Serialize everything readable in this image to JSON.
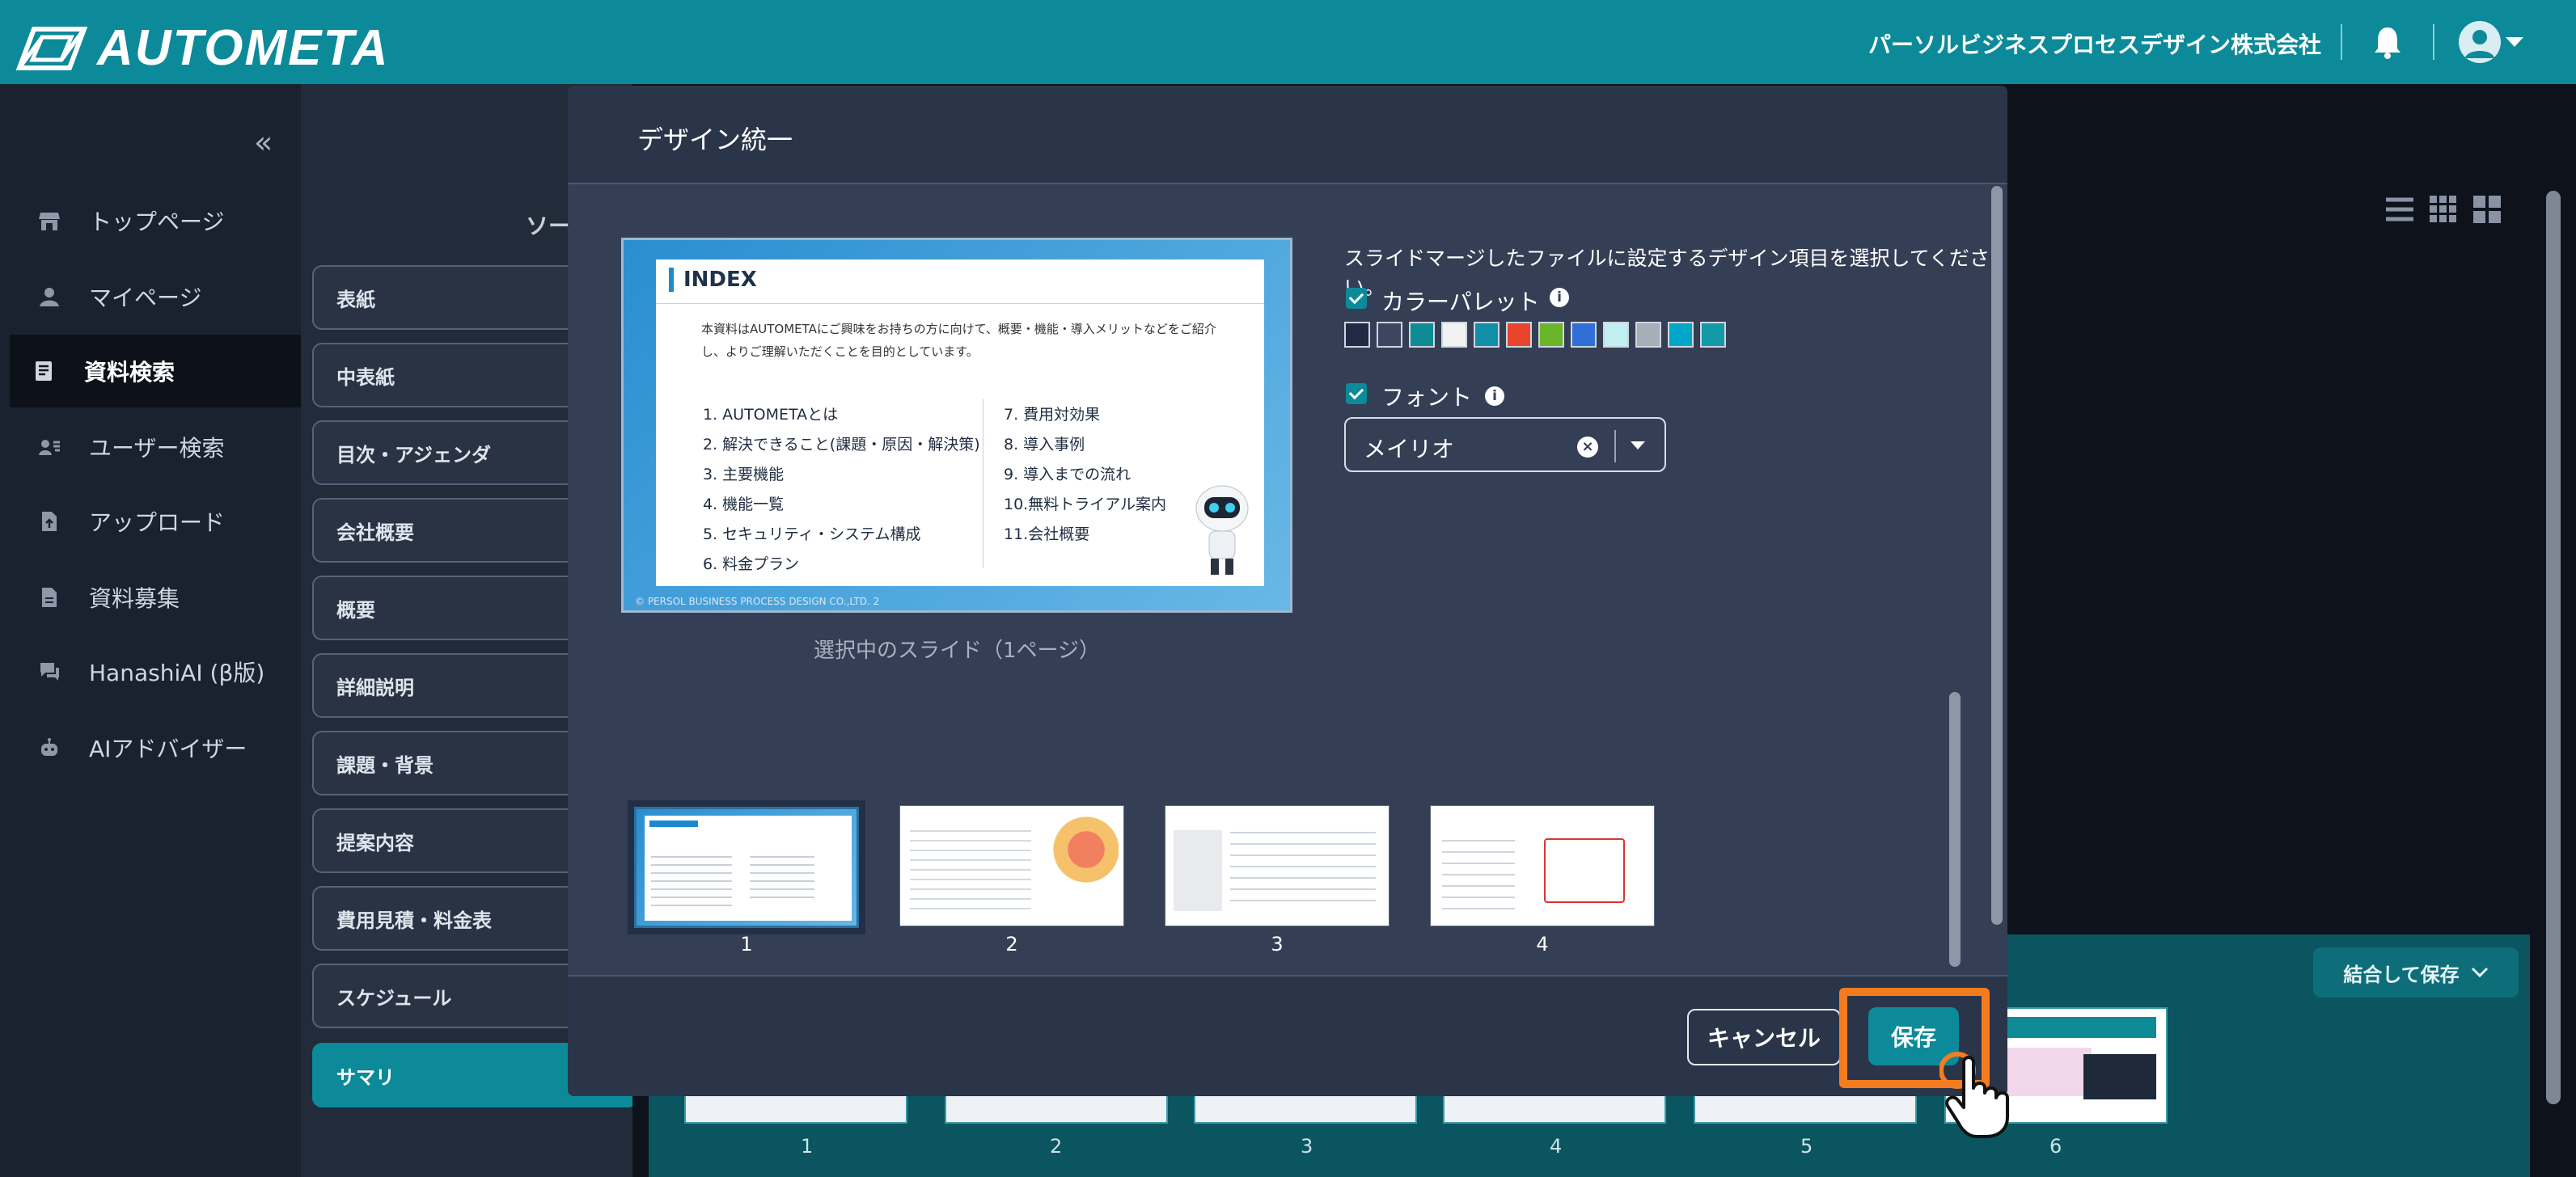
{
  "app": {
    "name": "AUTOMETA",
    "company": "パーソルビジネスプロセスデザイン株式会社"
  },
  "sidebar": {
    "collapse_glyph": "«",
    "items": [
      {
        "label": "トップページ",
        "icon": "store-icon"
      },
      {
        "label": "マイページ",
        "icon": "person-icon"
      },
      {
        "label": "資料検索",
        "icon": "document-search-icon",
        "active": true
      },
      {
        "label": "ユーザー検索",
        "icon": "user-search-icon"
      },
      {
        "label": "アップロード",
        "icon": "upload-file-icon"
      },
      {
        "label": "資料募集",
        "icon": "file-icon"
      },
      {
        "label": "HanashiAI (β版)",
        "icon": "chat-icon"
      },
      {
        "label": "AIアドバイザー",
        "icon": "robot-icon"
      }
    ]
  },
  "categories": {
    "sort_label": "ソー",
    "items": [
      "表紙",
      "中表紙",
      "目次・アジェンダ",
      "会社概要",
      "概要",
      "詳細説明",
      "課題・背景",
      "提案内容",
      "費用見積・料金表",
      "スケジュール",
      "サマリ"
    ],
    "active": "サマリ"
  },
  "tray": {
    "merge_label": "結合して保存",
    "numbers": [
      "1",
      "2",
      "3",
      "4",
      "5",
      "6"
    ]
  },
  "modal": {
    "title": "デザイン統一",
    "instruction": "スライドマージしたファイルに設定するデザイン項目を選択してください。",
    "color_palette": {
      "label": "カラーパレット",
      "checked": true,
      "colors": [
        "#1f2a44",
        "#3b4660",
        "#0f8b96",
        "#f2f2f2",
        "#118fa6",
        "#e8452c",
        "#6ab52a",
        "#2f6fd6",
        "#bfeff0",
        "#a7aeb8",
        "#00a7c9",
        "#129aa8"
      ]
    },
    "font": {
      "label": "フォント",
      "checked": true,
      "value": "メイリオ"
    },
    "selected_caption": "選択中のスライド（1ページ）",
    "preview": {
      "title": "INDEX",
      "intro": "本資料はAUTOMETAにご興味をお持ちの方に向けて、概要・機能・導入メリットなどをご紹介し、よりご理解いただくことを目的としています。",
      "left_items": [
        "1.  AUTOMETAとは",
        "2.  解決できること(課題・原因・解決策)",
        "3.  主要機能",
        "4.  機能一覧",
        "5.  セキュリティ・システム構成",
        "6.  料金プラン"
      ],
      "right_items": [
        "7.  費用対効果",
        "8.  導入事例",
        "9.  導入までの流れ",
        "10.無料トライアル案内",
        "11.会社概要"
      ],
      "footer": "© PERSOL BUSINESS PROCESS DESIGN CO.,LTD.   2"
    },
    "thumbnails": [
      "1",
      "2",
      "3",
      "4"
    ],
    "cancel_label": "キャンセル",
    "save_label": "保存"
  }
}
